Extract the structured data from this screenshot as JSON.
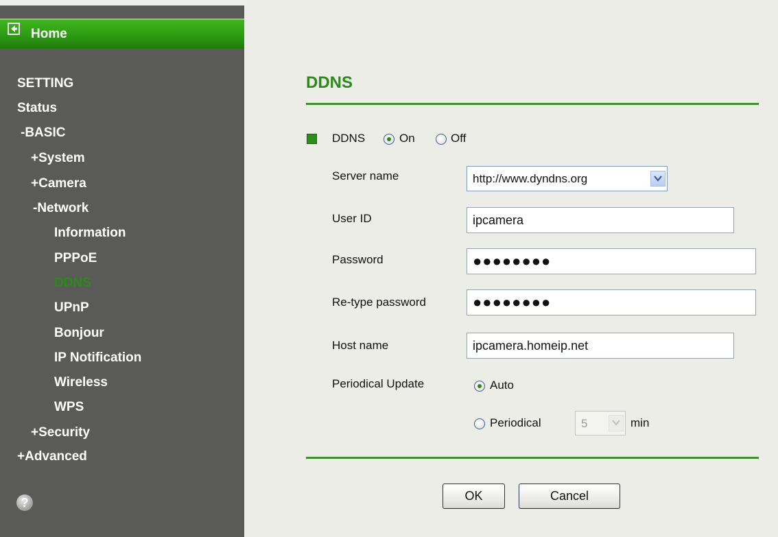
{
  "sidebar": {
    "home_label": "Home",
    "setting": "SETTING",
    "status": "Status",
    "basic": "-BASIC",
    "system": "+System",
    "camera": "+Camera",
    "network": "-Network",
    "network_items": [
      "Information",
      "PPPoE",
      "DDNS",
      "UPnP",
      "Bonjour",
      "IP Notification",
      "Wireless",
      "WPS"
    ],
    "security": "+Security",
    "advanced": "+Advanced",
    "help_glyph": "?"
  },
  "main": {
    "title": "DDNS",
    "ddns_label": "DDNS",
    "on_label": "On",
    "off_label": "Off",
    "ddns_enabled": "On",
    "server_name_label": "Server name",
    "server_name_value": "http://www.dyndns.org",
    "user_id_label": "User ID",
    "user_id_value": "ipcamera",
    "password_label": "Password",
    "password_mask": "●●●●●●●●",
    "retype_password_label": "Re-type password",
    "retype_password_mask": "●●●●●●●●",
    "host_name_label": "Host name",
    "host_name_value": "ipcamera.homeip.net",
    "periodical_update_label": "Periodical Update",
    "auto_label": "Auto",
    "periodical_label": "Periodical",
    "periodical_value": "5",
    "min_label": "min",
    "update_mode": "Auto",
    "ok_label": "OK",
    "cancel_label": "Cancel"
  },
  "colors": {
    "accent_green": "#2c8a1c",
    "sidebar_bg": "#5a5a58",
    "content_bg": "#ebede6"
  },
  "icons": {
    "home": "back-arrow-icon",
    "help": "help-icon",
    "dropdown": "chevron-down-icon",
    "section": "green-square-icon"
  }
}
